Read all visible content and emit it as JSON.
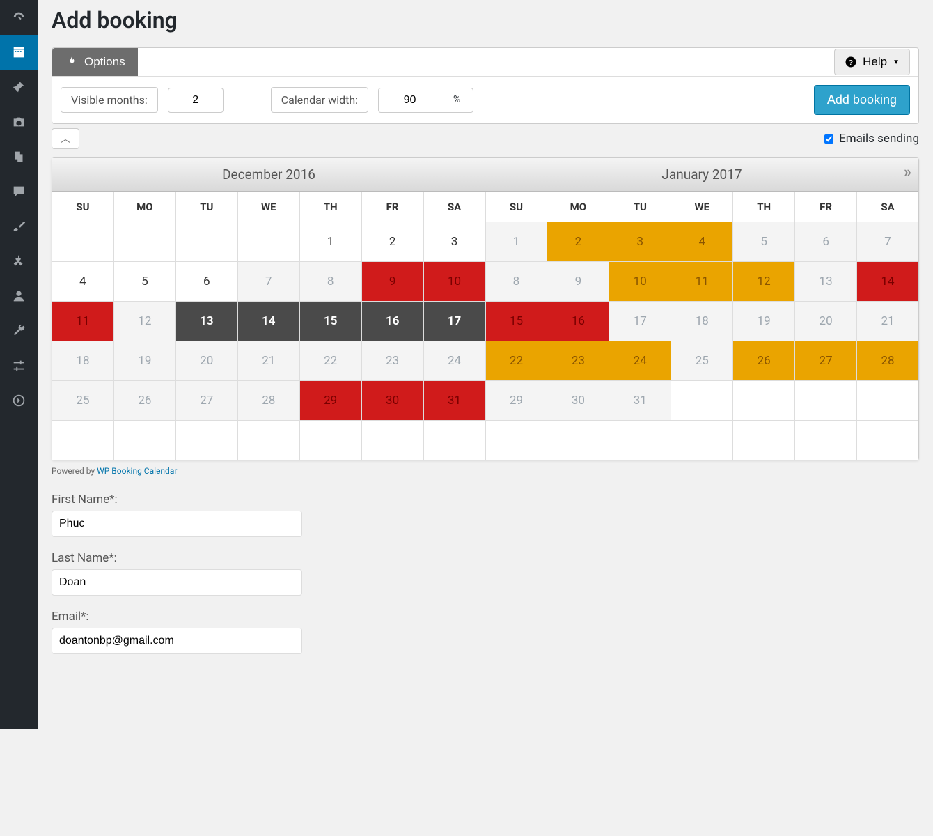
{
  "page_title": "Add booking",
  "tabs": {
    "options": "Options",
    "help": "Help"
  },
  "opts": {
    "visible_months_label": "Visible months:",
    "visible_months_value": "2",
    "calendar_width_label": "Calendar width:",
    "calendar_width_value": "90",
    "calendar_width_unit": "%"
  },
  "add_booking_btn": "Add booking",
  "emails_sending": "Emails sending",
  "months": [
    "December 2016",
    "January 2017"
  ],
  "week_headers": [
    "SU",
    "MO",
    "TU",
    "WE",
    "TH",
    "FR",
    "SA"
  ],
  "month1_weeks": [
    [
      {
        "n": "",
        "s": ""
      },
      {
        "n": "",
        "s": ""
      },
      {
        "n": "",
        "s": ""
      },
      {
        "n": "",
        "s": ""
      },
      {
        "n": "1",
        "s": ""
      },
      {
        "n": "2",
        "s": ""
      },
      {
        "n": "3",
        "s": ""
      }
    ],
    [
      {
        "n": "4",
        "s": ""
      },
      {
        "n": "5",
        "s": ""
      },
      {
        "n": "6",
        "s": ""
      },
      {
        "n": "7",
        "s": "dim"
      },
      {
        "n": "8",
        "s": "dim"
      },
      {
        "n": "9",
        "s": "red"
      },
      {
        "n": "10",
        "s": "red"
      }
    ],
    [
      {
        "n": "11",
        "s": "red"
      },
      {
        "n": "12",
        "s": "dim"
      },
      {
        "n": "13",
        "s": "dark"
      },
      {
        "n": "14",
        "s": "dark"
      },
      {
        "n": "15",
        "s": "dark"
      },
      {
        "n": "16",
        "s": "dark"
      },
      {
        "n": "17",
        "s": "dark"
      }
    ],
    [
      {
        "n": "18",
        "s": "dim"
      },
      {
        "n": "19",
        "s": "dim"
      },
      {
        "n": "20",
        "s": "dim"
      },
      {
        "n": "21",
        "s": "dim"
      },
      {
        "n": "22",
        "s": "dim"
      },
      {
        "n": "23",
        "s": "dim"
      },
      {
        "n": "24",
        "s": "dim"
      }
    ],
    [
      {
        "n": "25",
        "s": "dim"
      },
      {
        "n": "26",
        "s": "dim"
      },
      {
        "n": "27",
        "s": "dim"
      },
      {
        "n": "28",
        "s": "dim"
      },
      {
        "n": "29",
        "s": "red"
      },
      {
        "n": "30",
        "s": "red"
      },
      {
        "n": "31",
        "s": "red"
      }
    ],
    [
      {
        "n": "",
        "s": ""
      },
      {
        "n": "",
        "s": ""
      },
      {
        "n": "",
        "s": ""
      },
      {
        "n": "",
        "s": ""
      },
      {
        "n": "",
        "s": ""
      },
      {
        "n": "",
        "s": ""
      },
      {
        "n": "",
        "s": ""
      }
    ]
  ],
  "month2_weeks": [
    [
      {
        "n": "1",
        "s": "dim"
      },
      {
        "n": "2",
        "s": "amber"
      },
      {
        "n": "3",
        "s": "amber"
      },
      {
        "n": "4",
        "s": "amber"
      },
      {
        "n": "5",
        "s": "dim"
      },
      {
        "n": "6",
        "s": "dim"
      },
      {
        "n": "7",
        "s": "dim"
      }
    ],
    [
      {
        "n": "8",
        "s": "dim"
      },
      {
        "n": "9",
        "s": "dim"
      },
      {
        "n": "10",
        "s": "amber"
      },
      {
        "n": "11",
        "s": "amber"
      },
      {
        "n": "12",
        "s": "amber"
      },
      {
        "n": "13",
        "s": "dim"
      },
      {
        "n": "14",
        "s": "red"
      }
    ],
    [
      {
        "n": "15",
        "s": "red"
      },
      {
        "n": "16",
        "s": "red"
      },
      {
        "n": "17",
        "s": "dim"
      },
      {
        "n": "18",
        "s": "dim"
      },
      {
        "n": "19",
        "s": "dim"
      },
      {
        "n": "20",
        "s": "dim"
      },
      {
        "n": "21",
        "s": "dim"
      }
    ],
    [
      {
        "n": "22",
        "s": "amber"
      },
      {
        "n": "23",
        "s": "amber"
      },
      {
        "n": "24",
        "s": "amber"
      },
      {
        "n": "25",
        "s": "dim"
      },
      {
        "n": "26",
        "s": "amber"
      },
      {
        "n": "27",
        "s": "amber"
      },
      {
        "n": "28",
        "s": "amber"
      }
    ],
    [
      {
        "n": "29",
        "s": "dim"
      },
      {
        "n": "30",
        "s": "dim"
      },
      {
        "n": "31",
        "s": "dim"
      },
      {
        "n": "",
        "s": ""
      },
      {
        "n": "",
        "s": ""
      },
      {
        "n": "",
        "s": ""
      },
      {
        "n": "",
        "s": ""
      }
    ],
    [
      {
        "n": "",
        "s": ""
      },
      {
        "n": "",
        "s": ""
      },
      {
        "n": "",
        "s": ""
      },
      {
        "n": "",
        "s": ""
      },
      {
        "n": "",
        "s": ""
      },
      {
        "n": "",
        "s": ""
      },
      {
        "n": "",
        "s": ""
      }
    ]
  ],
  "powered": {
    "prefix": "Powered by ",
    "link": "WP Booking Calendar"
  },
  "form": {
    "first_name_label": "First Name*:",
    "first_name_value": "Phuc",
    "last_name_label": "Last Name*:",
    "last_name_value": "Doan",
    "email_label": "Email*:",
    "email_value": "doantonbp@gmail.com"
  }
}
